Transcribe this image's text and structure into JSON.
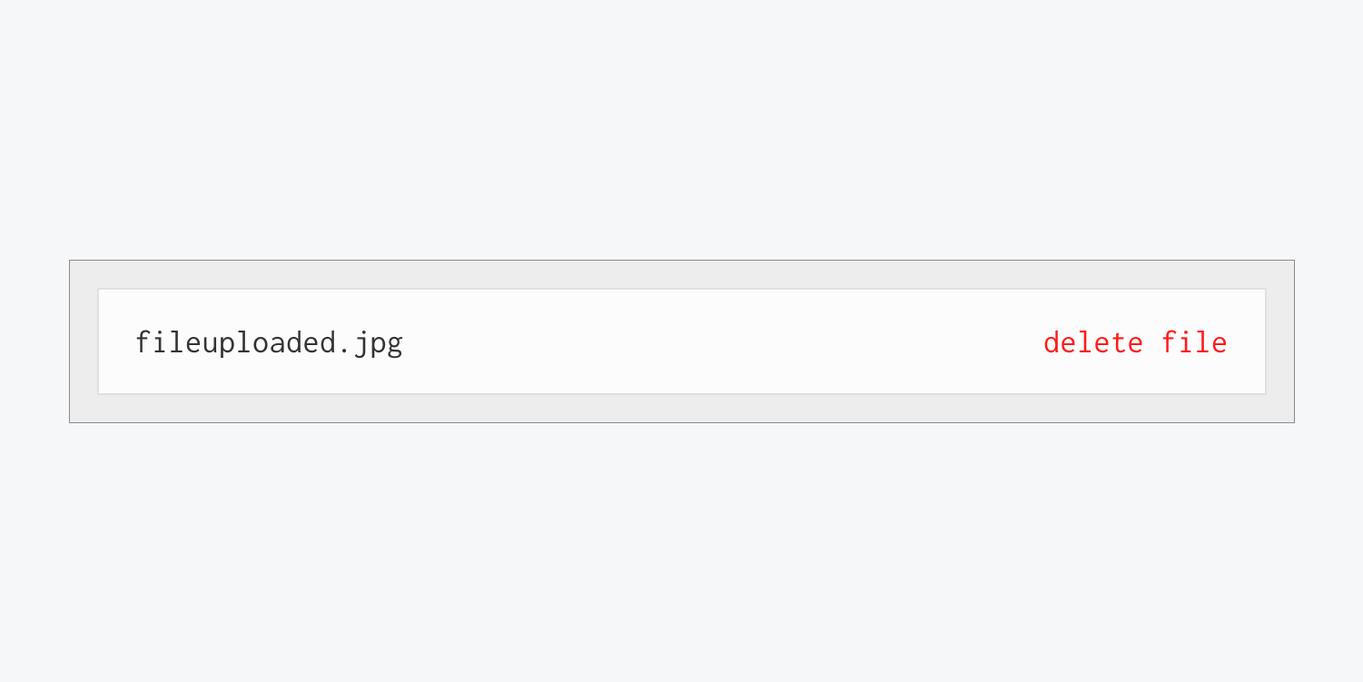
{
  "file": {
    "name": "fileuploaded.jpg",
    "delete_label": "delete file"
  }
}
